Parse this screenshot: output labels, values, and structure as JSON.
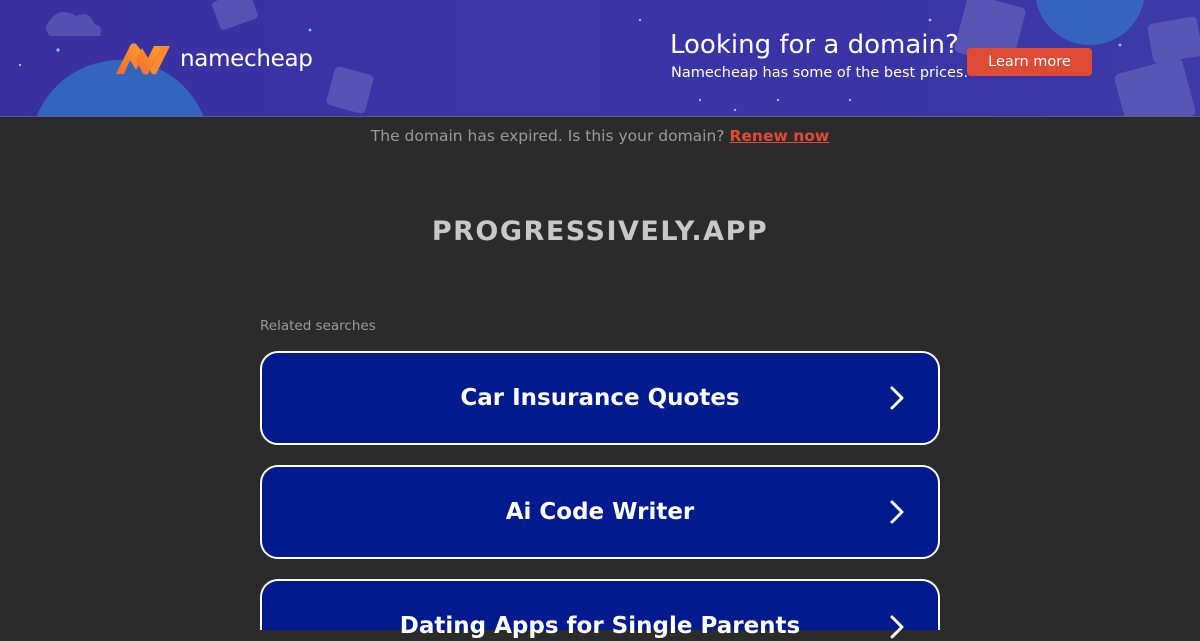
{
  "banner": {
    "brand_name": "namecheap",
    "promo_title": "Looking for a domain?",
    "promo_subtitle": "Namecheap has some of the best prices.",
    "cta_label": "Learn more",
    "accent_color": "#de4a34",
    "background_color": "#3a2f9e"
  },
  "notice": {
    "text": "The domain has expired. Is this your domain?",
    "link_label": "Renew now"
  },
  "domain_name": "PROGRESSIVELY.APP",
  "related": {
    "label": "Related searches",
    "items": [
      {
        "label": "Car Insurance Quotes"
      },
      {
        "label": "Ai Code Writer"
      },
      {
        "label": "Dating Apps for Single Parents"
      }
    ],
    "item_background": "#011a8d",
    "icon": "chevron-right-icon"
  }
}
